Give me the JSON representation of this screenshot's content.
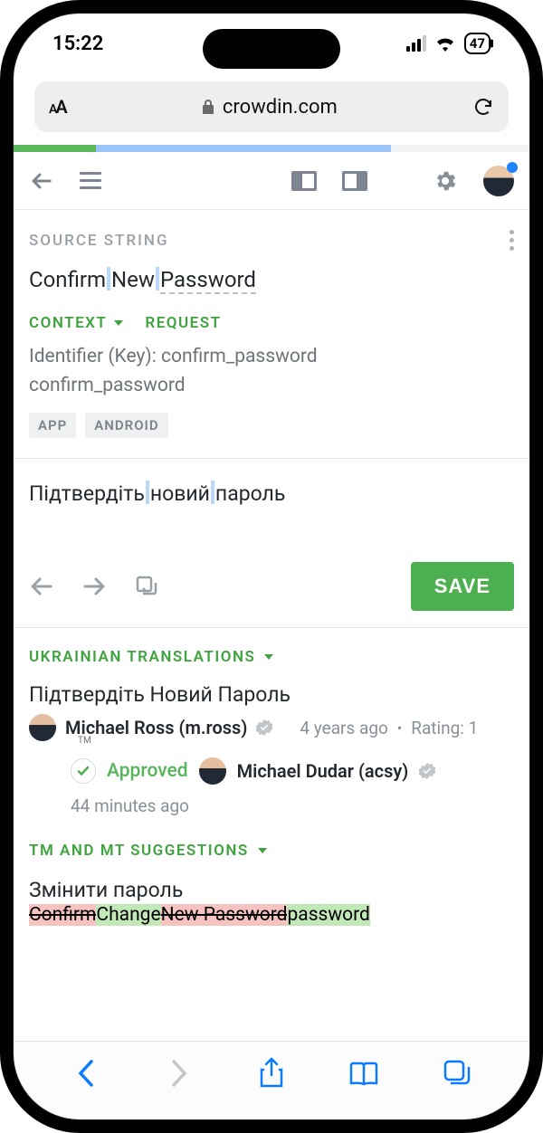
{
  "statusbar": {
    "time": "15:22",
    "battery": "47"
  },
  "browser": {
    "domain": "crowdin.com"
  },
  "source": {
    "section_label": "SOURCE STRING",
    "words": [
      "Confirm",
      "New",
      "Password"
    ],
    "context_label": "CONTEXT",
    "request_label": "REQUEST",
    "identifier_label": "Identifier (Key): confirm_password",
    "identifier_value": "confirm_password",
    "tags": [
      "APP",
      "ANDROID"
    ]
  },
  "translation_input": {
    "words": [
      "Підтвердіть",
      "новий",
      "пароль"
    ]
  },
  "actions": {
    "save": "SAVE"
  },
  "translations": {
    "section_label": "UKRAINIAN TRANSLATIONS",
    "item": {
      "text": "Підтвердіть Новий Пароль",
      "author": "Michael Ross (m.ross)",
      "tm_badge": "TM",
      "time": "4 years ago",
      "rating": "Rating: 1",
      "approved_label": "Approved",
      "approver": "Michael Dudar (acsy)",
      "approved_time": "44 minutes ago"
    }
  },
  "tm": {
    "section_label": "TM AND MT SUGGESTIONS",
    "item": {
      "text": "Змінити пароль",
      "diff": [
        {
          "t": "Confirm",
          "c": "del"
        },
        {
          "t": "Change",
          "c": "add"
        },
        {
          "t": " ",
          "c": ""
        },
        {
          "t": "New Password",
          "c": "del"
        },
        {
          "t": "password",
          "c": "add"
        }
      ]
    }
  }
}
